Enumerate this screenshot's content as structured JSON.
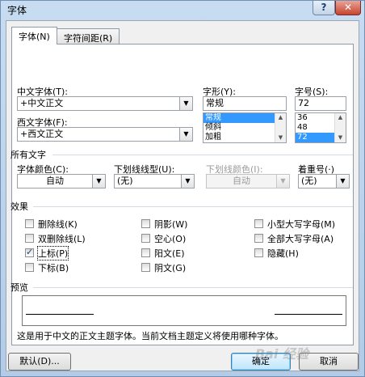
{
  "window": {
    "title": "字体",
    "help_label": "?",
    "close_label": "✕"
  },
  "tabs": [
    {
      "label": "字体(N)"
    },
    {
      "label": "字符间距(R)"
    }
  ],
  "font": {
    "chinese_label": "中文字体(T):",
    "chinese_value": "+中文正文",
    "western_label": "西文字体(F):",
    "western_value": "+西文正文",
    "style_label": "字形(Y):",
    "style_value": "常规",
    "style_options": [
      "常规",
      "倾斜",
      "加粗"
    ],
    "size_label": "字号(S):",
    "size_value": "72",
    "size_options": [
      "36",
      "48",
      "72"
    ]
  },
  "all_text": {
    "section": "所有文字",
    "font_color_label": "字体颜色(C):",
    "font_color_value": "自动",
    "underline_label": "下划线线型(U):",
    "underline_value": "(无)",
    "underline_color_label": "下划线颜色(I):",
    "underline_color_value": "自动",
    "emphasis_label": "着重号(·)",
    "emphasis_value": "(无)"
  },
  "effects": {
    "section": "效果",
    "items": [
      {
        "label": "删除线(K)",
        "checked": false
      },
      {
        "label": "双删除线(L)",
        "checked": false
      },
      {
        "label": "上标(P)",
        "checked": true
      },
      {
        "label": "下标(B)",
        "checked": false
      },
      {
        "label": "阴影(W)",
        "checked": false
      },
      {
        "label": "空心(O)",
        "checked": false
      },
      {
        "label": "阳文(E)",
        "checked": false
      },
      {
        "label": "阴文(G)",
        "checked": false
      },
      {
        "label": "小型大写字母(M)",
        "checked": false
      },
      {
        "label": "全部大写字母(A)",
        "checked": false
      },
      {
        "label": "隐藏(H)",
        "checked": false
      }
    ]
  },
  "preview": {
    "section": "预览",
    "description": "这是用于中文的正文主题字体。当前文档主题定义将使用哪种字体。"
  },
  "buttons": {
    "default": "默认(D)...",
    "ok": "确定",
    "cancel": "取消"
  },
  "watermark": "Bai 经验"
}
